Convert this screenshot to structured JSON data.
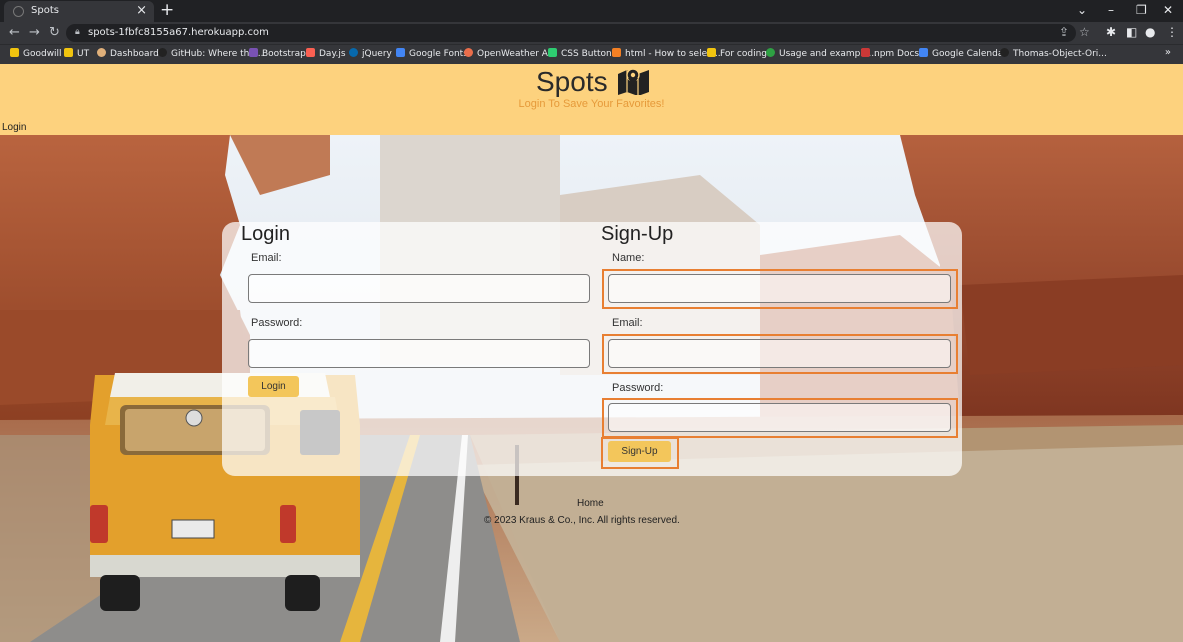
{
  "browser": {
    "tab_title": "Spots",
    "url": "spots-1fbfc8155a67.herokuapp.com",
    "bookmarks": [
      "Goodwill",
      "UT",
      "Dashboard",
      "GitHub: Where the...",
      "Bootstrap",
      "Day.js",
      "jQuery",
      "Google Fonts",
      "OpenWeather API",
      "CSS Buttons",
      "html - How to selec...",
      "For coding",
      "Usage and example...",
      "npm Docs",
      "Google Calendar",
      "Thomas-Object-Ori..."
    ]
  },
  "header": {
    "brand": "Spots",
    "subtitle": "Login To Save Your Favorites!",
    "nav_login": "Login"
  },
  "login": {
    "title": "Login",
    "email_label": "Email:",
    "password_label": "Password:",
    "button": "Login"
  },
  "signup": {
    "title": "Sign-Up",
    "name_label": "Name:",
    "email_label": "Email:",
    "password_label": "Password:",
    "button": "Sign-Up"
  },
  "footer": {
    "home": "Home",
    "copyright": "© 2023 Kraus & Co., Inc. All rights reserved."
  },
  "colors": {
    "header_bg": "#fdd27e",
    "accent": "#e69a3a",
    "button": "#f3c65b",
    "highlight": "#e87f32"
  }
}
